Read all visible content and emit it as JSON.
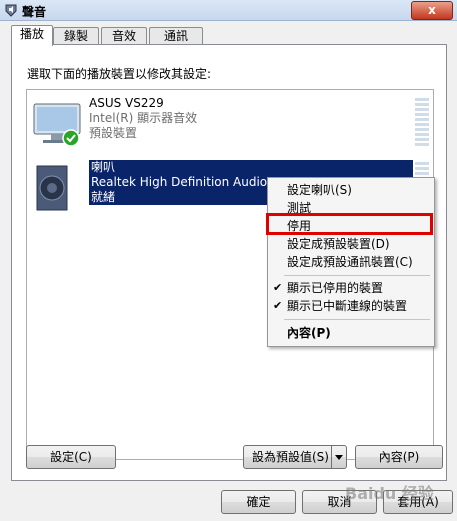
{
  "window": {
    "title": "聲音",
    "close": "x"
  },
  "tabs": [
    {
      "label": "播放",
      "active": true
    },
    {
      "label": "錄製"
    },
    {
      "label": "音效"
    },
    {
      "label": "通訊"
    }
  ],
  "instruction": "選取下面的播放裝置以修改其設定:",
  "devices": [
    {
      "name": "ASUS VS229",
      "desc": "Intel(R) 顯示器音效",
      "status": "預設裝置"
    },
    {
      "name": "喇叭",
      "desc": "Realtek High Definition Audio",
      "status": "就緒"
    }
  ],
  "context_menu": {
    "items": [
      {
        "label": "設定喇叭(S)"
      },
      {
        "label": "測試"
      },
      {
        "label": "停用",
        "highlighted": true
      },
      {
        "label": "設定成預設裝置(D)"
      },
      {
        "label": "設定成預設通訊裝置(C)"
      },
      {
        "label": "顯示已停用的裝置",
        "checked": true
      },
      {
        "label": "顯示已中斷連線的裝置",
        "checked": true
      },
      {
        "label": "內容(P)",
        "bold": true
      }
    ]
  },
  "buttons": {
    "configure": "設定(C)",
    "set_default": "設為預設值(S)",
    "properties": "內容(P)",
    "ok": "確定",
    "cancel": "取消",
    "apply": "套用(A)"
  },
  "colors": {
    "selection": "#0a246a",
    "highlight_box": "#e00000",
    "check_green": "#2aa52a"
  },
  "watermark": "Baidu 经验"
}
